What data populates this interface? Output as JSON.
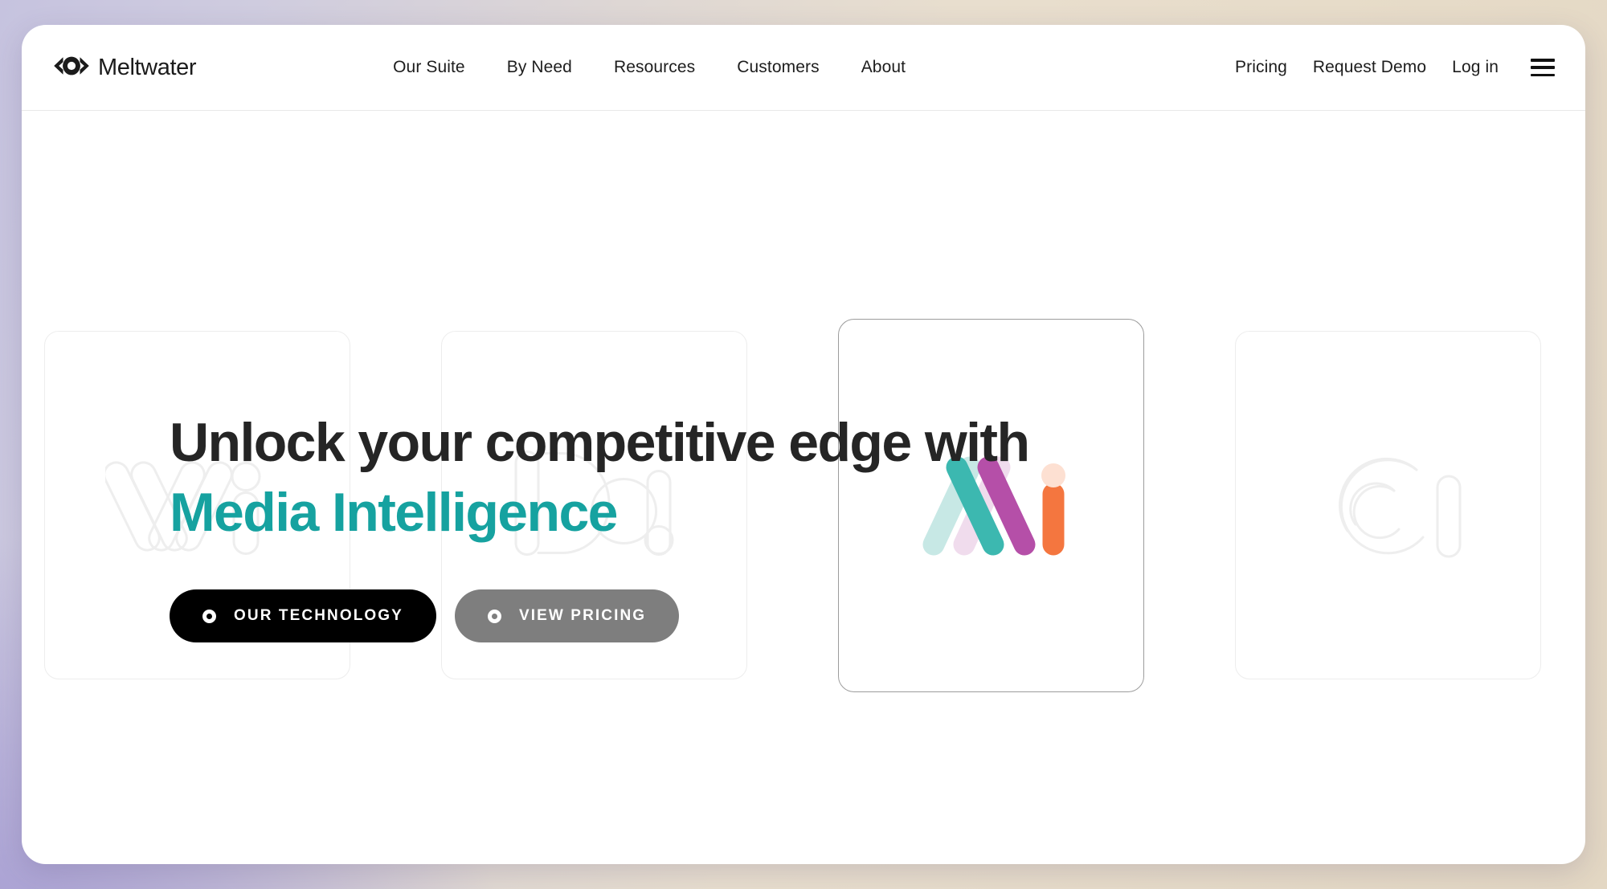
{
  "brand": {
    "name": "Meltwater",
    "logo_icon": "meltwater-eye-icon"
  },
  "nav": {
    "main_items": [
      {
        "label": "Our Suite"
      },
      {
        "label": "By Need"
      },
      {
        "label": "Resources"
      },
      {
        "label": "Customers"
      },
      {
        "label": "About"
      }
    ],
    "right_items": [
      {
        "label": "Pricing"
      },
      {
        "label": "Request Demo"
      },
      {
        "label": "Log in"
      }
    ],
    "menu_icon": "hamburger-menu-icon"
  },
  "hero": {
    "title_line1": "Unlock your competitive edge with",
    "title_line2": "Media Intelligence",
    "accent_color": "#16a2a0",
    "title_color": "#252525",
    "buttons": [
      {
        "label": "Our Technology",
        "icon": "ring-dot-icon",
        "style": "primary",
        "bg": "#000000"
      },
      {
        "label": "View Pricing",
        "icon": "ring-dot-icon",
        "style": "secondary",
        "bg": "#7e7e7e"
      }
    ],
    "cards": [
      {
        "watermark": "Mi",
        "active": false
      },
      {
        "watermark": "Da",
        "active": false
      },
      {
        "watermark": "Mi",
        "active": true
      },
      {
        "watermark": "Ci",
        "active": false
      }
    ],
    "logo_colors": {
      "teal_light": "#c7e8e5",
      "teal": "#3cb8b0",
      "pink_light": "#f0dced",
      "magenta": "#b54fa8",
      "orange": "#f4763f",
      "peach": "#fde0d2"
    }
  },
  "page_background": {
    "gradient_from": "#c6c3df",
    "gradient_to": "#e3d7c3"
  }
}
